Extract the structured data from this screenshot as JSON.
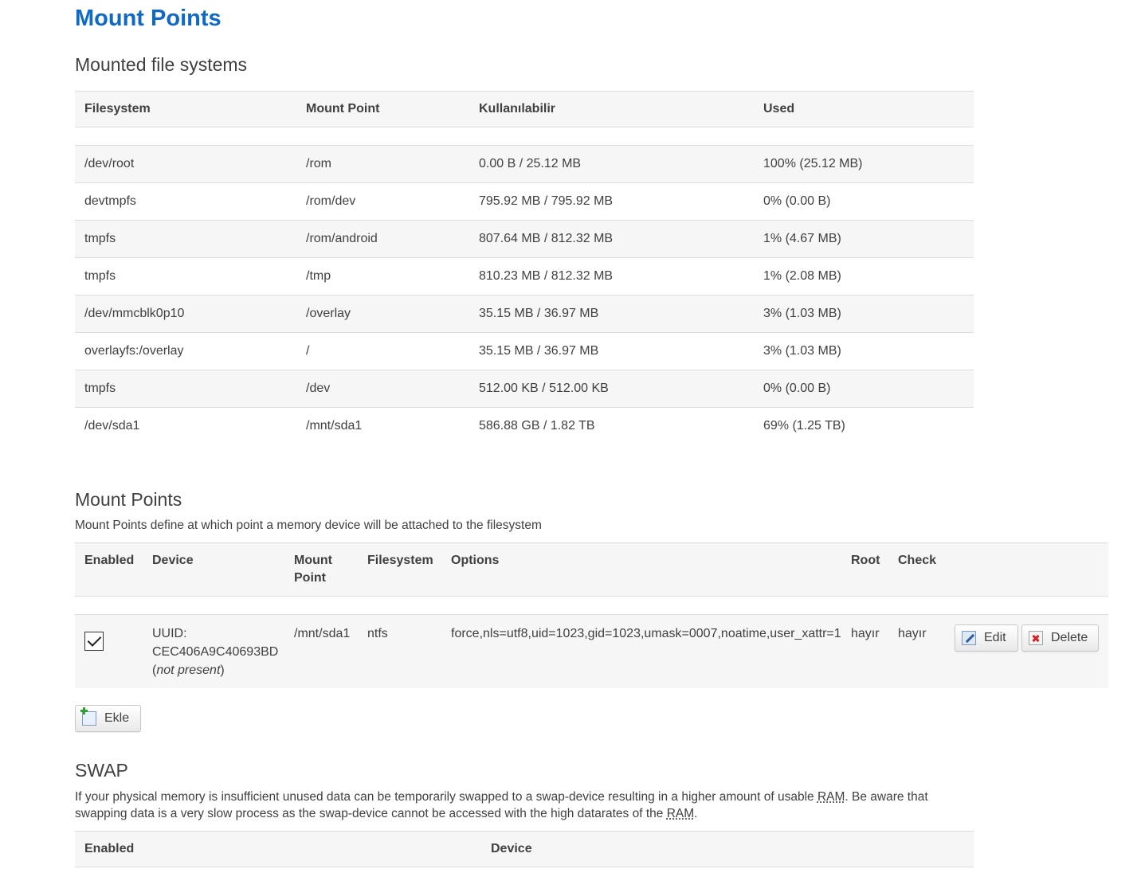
{
  "page_title": "Mount Points",
  "mounted": {
    "title": "Mounted file systems",
    "headers": [
      "Filesystem",
      "Mount Point",
      "Kullanılabilir",
      "Used"
    ],
    "rows": [
      [
        "/dev/root",
        "/rom",
        "0.00 B / 25.12 MB",
        "100% (25.12 MB)"
      ],
      [
        "devtmpfs",
        "/rom/dev",
        "795.92 MB / 795.92 MB",
        "0% (0.00 B)"
      ],
      [
        "tmpfs",
        "/rom/android",
        "807.64 MB / 812.32 MB",
        "1% (4.67 MB)"
      ],
      [
        "tmpfs",
        "/tmp",
        "810.23 MB / 812.32 MB",
        "1% (2.08 MB)"
      ],
      [
        "/dev/mmcblk0p10",
        "/overlay",
        "35.15 MB / 36.97 MB",
        "3% (1.03 MB)"
      ],
      [
        "overlayfs:/overlay",
        "/",
        "35.15 MB / 36.97 MB",
        "3% (1.03 MB)"
      ],
      [
        "tmpfs",
        "/dev",
        "512.00 KB / 512.00 KB",
        "0% (0.00 B)"
      ],
      [
        "/dev/sda1",
        "/mnt/sda1",
        "586.88 GB / 1.82 TB",
        "69% (1.25 TB)"
      ]
    ]
  },
  "mount_points": {
    "title": "Mount Points",
    "description": "Mount Points define at which point a memory device will be attached to the filesystem",
    "headers": {
      "enabled": "Enabled",
      "device": "Device",
      "mount_point_1": "Mount",
      "mount_point_2": "Point",
      "filesystem": "Filesystem",
      "options": "Options",
      "root": "Root",
      "check": "Check"
    },
    "rows": [
      {
        "enabled": true,
        "device_line1": "UUID:",
        "device_line2": "CEC406A9C40693BD",
        "device_status": "not present",
        "mount_point": "/mnt/sda1",
        "filesystem": "ntfs",
        "options": "force,nls=utf8,uid=1023,gid=1023,umask=0007,noatime,user_xattr=1",
        "root": "hayır",
        "check": "hayır",
        "edit_label": "Edit",
        "delete_label": "Delete"
      }
    ],
    "add_label": "Ekle"
  },
  "swap": {
    "title": "SWAP",
    "desc_part1": "If your physical memory is insufficient unused data can be temporarily swapped to a swap-device resulting in a higher amount of usable ",
    "desc_abbr1": "RAM",
    "desc_part2": ". Be aware that swapping data is a very slow process as the swap-device cannot be accessed with the high datarates of the ",
    "desc_abbr2": "RAM",
    "desc_part3": ".",
    "headers": [
      "Enabled",
      "Device"
    ]
  },
  "icons": [
    "edit-icon",
    "delete-icon",
    "add-icon",
    "checkbox-checked"
  ]
}
